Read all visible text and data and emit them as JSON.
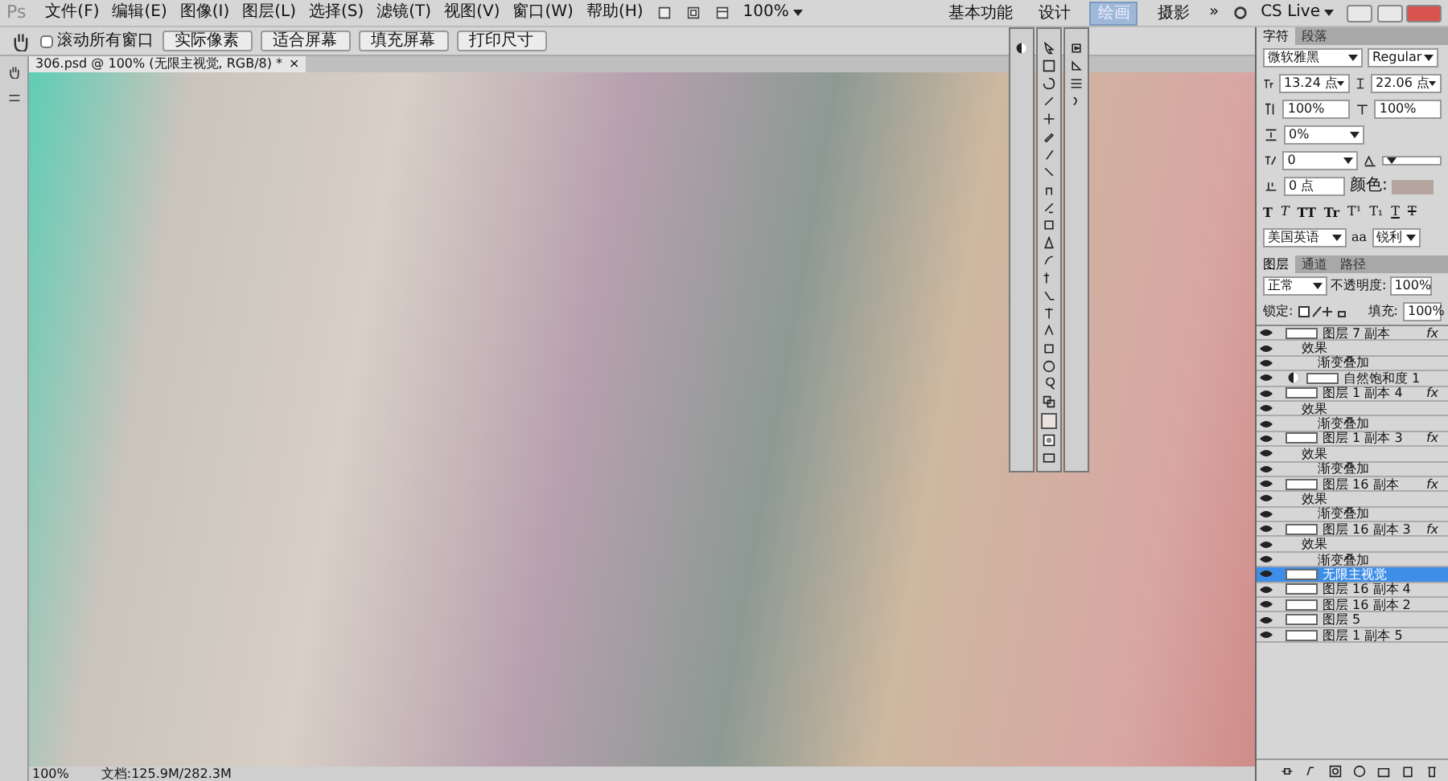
{
  "app_logo": "Ps",
  "menu": [
    "文件(F)",
    "编辑(E)",
    "图像(I)",
    "图层(L)",
    "选择(S)",
    "滤镜(T)",
    "视图(V)",
    "窗口(W)",
    "帮助(H)"
  ],
  "zoom_menu": "100%",
  "workspaces": [
    {
      "label": "基本功能",
      "selected": false
    },
    {
      "label": "设计",
      "selected": false
    },
    {
      "label": "绘画",
      "selected": true
    },
    {
      "label": "摄影",
      "selected": false
    }
  ],
  "more_workspaces": "»",
  "cs_live": "CS Live",
  "options_bar": {
    "scroll_all": {
      "label": "滚动所有窗口",
      "checked": false
    },
    "buttons": [
      "实际像素",
      "适合屏幕",
      "填充屏幕",
      "打印尺寸"
    ]
  },
  "document_tab": {
    "title": "306.psd @ 100% (无限主视觉, RGB/8) *",
    "close": "×"
  },
  "status_bar": {
    "zoom": "100%",
    "doc_size": "文档:125.9M/282.3M"
  },
  "character_panel": {
    "tabs": [
      {
        "label": "字符",
        "selected": true
      },
      {
        "label": "段落",
        "selected": false
      }
    ],
    "font": "微软雅黑",
    "style": "Regular",
    "size": "13.24 点",
    "leading": "22.06 点",
    "vertical_scale": "100%",
    "horizontal_scale": "100%",
    "tsume": "0%",
    "kerning": "0",
    "baseline": "0 点",
    "color_label": "颜色:",
    "color": "#b3a59e",
    "style_buttons": [
      {
        "kind": "bold",
        "label": "T"
      },
      {
        "kind": "italic",
        "label": "T"
      },
      {
        "kind": "caps",
        "label": "TT"
      },
      {
        "kind": "smallcaps",
        "label": "Tr"
      },
      {
        "kind": "super",
        "label": "T¹"
      },
      {
        "kind": "sub",
        "label": "T₁"
      },
      {
        "kind": "underline",
        "label": "T"
      },
      {
        "kind": "strike",
        "label": "T"
      }
    ],
    "language": "美国英语",
    "aa_label": "aa",
    "antialias": "锐利"
  },
  "layers_panel": {
    "tabs": [
      {
        "label": "图层",
        "selected": true
      },
      {
        "label": "通道",
        "selected": false
      },
      {
        "label": "路径",
        "selected": false
      }
    ],
    "blend_mode": "正常",
    "opacity_label": "不透明度:",
    "opacity": "100%",
    "lock_label": "锁定:",
    "fill_label": "填充:",
    "fill": "100%",
    "layers": [
      {
        "kind": "layer",
        "name": "图层 7 副本",
        "visible": true,
        "selected": false,
        "fx": "fx",
        "children": [
          {
            "kind": "effects",
            "name": "效果",
            "visible": true,
            "children": [
              {
                "kind": "effect",
                "name": "渐变叠加",
                "visible": true
              }
            ]
          }
        ]
      },
      {
        "kind": "adjustment",
        "name": "自然饱和度 1",
        "visible": true,
        "selected": false
      },
      {
        "kind": "layer",
        "name": "图层 1 副本 4",
        "visible": true,
        "selected": false,
        "fx": "fx",
        "children": [
          {
            "kind": "effects",
            "name": "效果",
            "visible": true,
            "children": [
              {
                "kind": "effect",
                "name": "渐变叠加",
                "visible": true
              }
            ]
          }
        ]
      },
      {
        "kind": "layer",
        "name": "图层 1 副本 3",
        "visible": true,
        "selected": false,
        "fx": "fx",
        "children": [
          {
            "kind": "effects",
            "name": "效果",
            "visible": true,
            "children": [
              {
                "kind": "effect",
                "name": "渐变叠加",
                "visible": true
              }
            ]
          }
        ]
      },
      {
        "kind": "layer",
        "name": "图层 16 副本",
        "visible": true,
        "selected": false,
        "fx": "fx",
        "children": [
          {
            "kind": "effects",
            "name": "效果",
            "visible": true,
            "children": [
              {
                "kind": "effect",
                "name": "渐变叠加",
                "visible": true
              }
            ]
          }
        ]
      },
      {
        "kind": "layer",
        "name": "图层 16 副本 3",
        "visible": true,
        "selected": false,
        "fx": "fx",
        "children": [
          {
            "kind": "effects",
            "name": "效果",
            "visible": true,
            "children": [
              {
                "kind": "effect",
                "name": "渐变叠加",
                "visible": true
              }
            ]
          }
        ]
      },
      {
        "kind": "layer",
        "name": "无限主视觉",
        "visible": true,
        "selected": true
      },
      {
        "kind": "layer",
        "name": "图层 16 副本 4",
        "visible": true,
        "selected": false
      },
      {
        "kind": "layer",
        "name": "图层 16 副本 2",
        "visible": true,
        "selected": false
      },
      {
        "kind": "layer",
        "name": "图层 5",
        "visible": true,
        "selected": false
      },
      {
        "kind": "layer",
        "name": "图层 1 副本 5",
        "visible": true,
        "selected": false
      }
    ]
  }
}
